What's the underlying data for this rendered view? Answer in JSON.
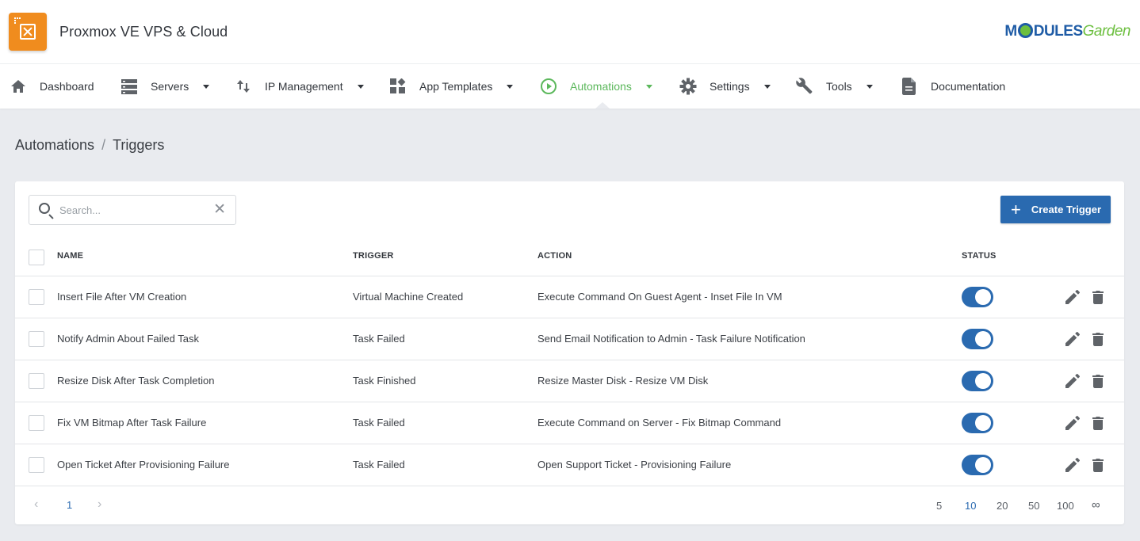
{
  "app": {
    "title": "Proxmox VE VPS & Cloud",
    "vendor_logo_a": "M",
    "vendor_logo_b": "DULES",
    "vendor_logo_c": "Garden"
  },
  "nav": {
    "items": [
      {
        "label": "Dashboard",
        "icon": "home-icon",
        "dropdown": false
      },
      {
        "label": "Servers",
        "icon": "server-icon",
        "dropdown": true
      },
      {
        "label": "IP Management",
        "icon": "sort-arrows-icon",
        "dropdown": true
      },
      {
        "label": "App Templates",
        "icon": "widgets-icon",
        "dropdown": true
      },
      {
        "label": "Automations",
        "icon": "play-circle-icon",
        "dropdown": true,
        "active": true
      },
      {
        "label": "Settings",
        "icon": "gear-icon",
        "dropdown": true
      },
      {
        "label": "Tools",
        "icon": "wrench-icon",
        "dropdown": true
      },
      {
        "label": "Documentation",
        "icon": "document-icon",
        "dropdown": false
      }
    ]
  },
  "breadcrumb": {
    "section": "Automations",
    "separator": "/",
    "page": "Triggers"
  },
  "toolbar": {
    "search_placeholder": "Search...",
    "search_value": "",
    "create_label": "Create Trigger"
  },
  "table": {
    "columns": {
      "name": "NAME",
      "trigger": "TRIGGER",
      "action": "ACTION",
      "status": "STATUS"
    },
    "rows": [
      {
        "name": "Insert File After VM Creation",
        "trigger": "Virtual Machine Created",
        "action": "Execute Command On Guest Agent - Inset File In VM",
        "status": "enabled"
      },
      {
        "name": "Notify Admin About Failed Task",
        "trigger": "Task Failed",
        "action": "Send Email Notification to Admin - Task Failure Notification",
        "status": "enabled"
      },
      {
        "name": "Resize Disk After Task Completion",
        "trigger": "Task Finished",
        "action": "Resize Master Disk - Resize VM Disk",
        "status": "enabled"
      },
      {
        "name": "Fix VM Bitmap After Task Failure",
        "trigger": "Task Failed",
        "action": "Execute Command on Server - Fix Bitmap Command",
        "status": "enabled"
      },
      {
        "name": "Open Ticket After Provisioning Failure",
        "trigger": "Task Failed",
        "action": "Open Support Ticket - Provisioning Failure",
        "status": "enabled"
      }
    ]
  },
  "pagination": {
    "current_page": "1",
    "page_sizes": [
      "5",
      "10",
      "20",
      "50",
      "100",
      "∞"
    ],
    "selected_page_size": "10"
  },
  "colors": {
    "primary": "#2a6ab0",
    "active_nav": "#5cb85c",
    "brand_orange": "#f08c1e"
  }
}
